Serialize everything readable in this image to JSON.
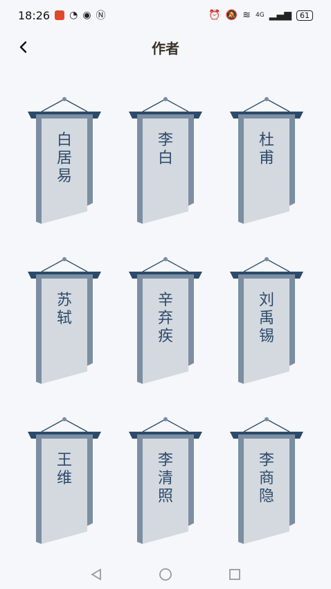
{
  "status": {
    "time": "18:26",
    "signal": "4G",
    "battery": "61"
  },
  "header": {
    "title": "作者"
  },
  "authors": [
    "白居易",
    "李白",
    "杜甫",
    "苏轼",
    "辛弃疾",
    "刘禹锡",
    "王维",
    "李清照",
    "李商隐"
  ],
  "colors": {
    "pole": "#2c4a6a",
    "banner": "#d3d9df",
    "shade": "#7c8ea1"
  }
}
